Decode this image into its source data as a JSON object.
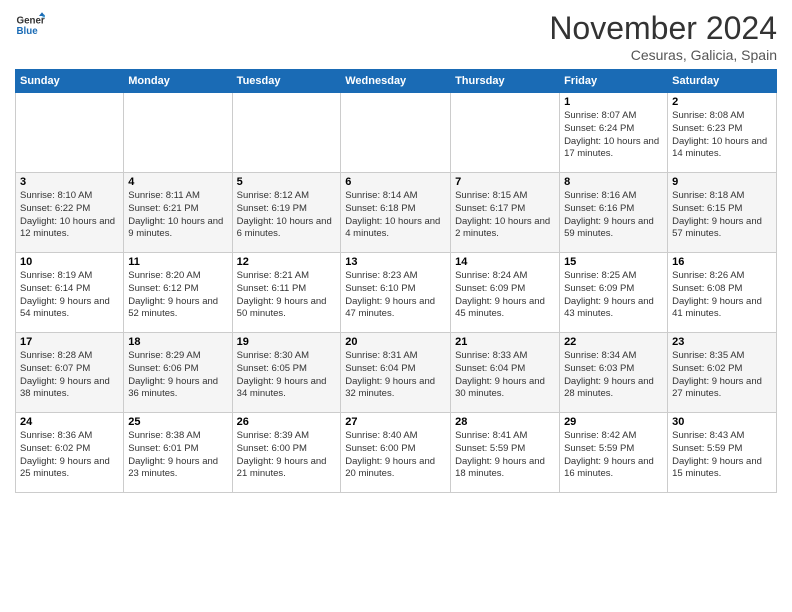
{
  "logo": {
    "general": "General",
    "blue": "Blue"
  },
  "header": {
    "month": "November 2024",
    "location": "Cesuras, Galicia, Spain"
  },
  "weekdays": [
    "Sunday",
    "Monday",
    "Tuesday",
    "Wednesday",
    "Thursday",
    "Friday",
    "Saturday"
  ],
  "weeks": [
    [
      {
        "day": "",
        "info": ""
      },
      {
        "day": "",
        "info": ""
      },
      {
        "day": "",
        "info": ""
      },
      {
        "day": "",
        "info": ""
      },
      {
        "day": "",
        "info": ""
      },
      {
        "day": "1",
        "info": "Sunrise: 8:07 AM\nSunset: 6:24 PM\nDaylight: 10 hours and 17 minutes."
      },
      {
        "day": "2",
        "info": "Sunrise: 8:08 AM\nSunset: 6:23 PM\nDaylight: 10 hours and 14 minutes."
      }
    ],
    [
      {
        "day": "3",
        "info": "Sunrise: 8:10 AM\nSunset: 6:22 PM\nDaylight: 10 hours and 12 minutes."
      },
      {
        "day": "4",
        "info": "Sunrise: 8:11 AM\nSunset: 6:21 PM\nDaylight: 10 hours and 9 minutes."
      },
      {
        "day": "5",
        "info": "Sunrise: 8:12 AM\nSunset: 6:19 PM\nDaylight: 10 hours and 6 minutes."
      },
      {
        "day": "6",
        "info": "Sunrise: 8:14 AM\nSunset: 6:18 PM\nDaylight: 10 hours and 4 minutes."
      },
      {
        "day": "7",
        "info": "Sunrise: 8:15 AM\nSunset: 6:17 PM\nDaylight: 10 hours and 2 minutes."
      },
      {
        "day": "8",
        "info": "Sunrise: 8:16 AM\nSunset: 6:16 PM\nDaylight: 9 hours and 59 minutes."
      },
      {
        "day": "9",
        "info": "Sunrise: 8:18 AM\nSunset: 6:15 PM\nDaylight: 9 hours and 57 minutes."
      }
    ],
    [
      {
        "day": "10",
        "info": "Sunrise: 8:19 AM\nSunset: 6:14 PM\nDaylight: 9 hours and 54 minutes."
      },
      {
        "day": "11",
        "info": "Sunrise: 8:20 AM\nSunset: 6:12 PM\nDaylight: 9 hours and 52 minutes."
      },
      {
        "day": "12",
        "info": "Sunrise: 8:21 AM\nSunset: 6:11 PM\nDaylight: 9 hours and 50 minutes."
      },
      {
        "day": "13",
        "info": "Sunrise: 8:23 AM\nSunset: 6:10 PM\nDaylight: 9 hours and 47 minutes."
      },
      {
        "day": "14",
        "info": "Sunrise: 8:24 AM\nSunset: 6:09 PM\nDaylight: 9 hours and 45 minutes."
      },
      {
        "day": "15",
        "info": "Sunrise: 8:25 AM\nSunset: 6:09 PM\nDaylight: 9 hours and 43 minutes."
      },
      {
        "day": "16",
        "info": "Sunrise: 8:26 AM\nSunset: 6:08 PM\nDaylight: 9 hours and 41 minutes."
      }
    ],
    [
      {
        "day": "17",
        "info": "Sunrise: 8:28 AM\nSunset: 6:07 PM\nDaylight: 9 hours and 38 minutes."
      },
      {
        "day": "18",
        "info": "Sunrise: 8:29 AM\nSunset: 6:06 PM\nDaylight: 9 hours and 36 minutes."
      },
      {
        "day": "19",
        "info": "Sunrise: 8:30 AM\nSunset: 6:05 PM\nDaylight: 9 hours and 34 minutes."
      },
      {
        "day": "20",
        "info": "Sunrise: 8:31 AM\nSunset: 6:04 PM\nDaylight: 9 hours and 32 minutes."
      },
      {
        "day": "21",
        "info": "Sunrise: 8:33 AM\nSunset: 6:04 PM\nDaylight: 9 hours and 30 minutes."
      },
      {
        "day": "22",
        "info": "Sunrise: 8:34 AM\nSunset: 6:03 PM\nDaylight: 9 hours and 28 minutes."
      },
      {
        "day": "23",
        "info": "Sunrise: 8:35 AM\nSunset: 6:02 PM\nDaylight: 9 hours and 27 minutes."
      }
    ],
    [
      {
        "day": "24",
        "info": "Sunrise: 8:36 AM\nSunset: 6:02 PM\nDaylight: 9 hours and 25 minutes."
      },
      {
        "day": "25",
        "info": "Sunrise: 8:38 AM\nSunset: 6:01 PM\nDaylight: 9 hours and 23 minutes."
      },
      {
        "day": "26",
        "info": "Sunrise: 8:39 AM\nSunset: 6:00 PM\nDaylight: 9 hours and 21 minutes."
      },
      {
        "day": "27",
        "info": "Sunrise: 8:40 AM\nSunset: 6:00 PM\nDaylight: 9 hours and 20 minutes."
      },
      {
        "day": "28",
        "info": "Sunrise: 8:41 AM\nSunset: 5:59 PM\nDaylight: 9 hours and 18 minutes."
      },
      {
        "day": "29",
        "info": "Sunrise: 8:42 AM\nSunset: 5:59 PM\nDaylight: 9 hours and 16 minutes."
      },
      {
        "day": "30",
        "info": "Sunrise: 8:43 AM\nSunset: 5:59 PM\nDaylight: 9 hours and 15 minutes."
      }
    ]
  ]
}
